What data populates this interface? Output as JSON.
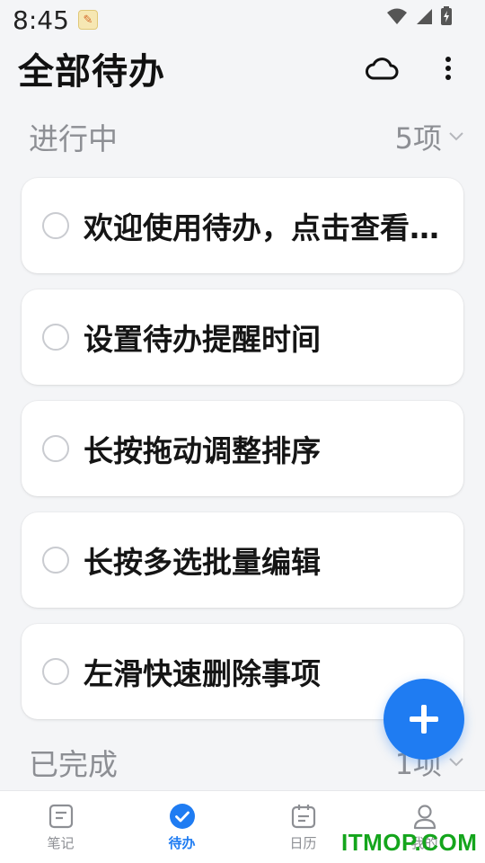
{
  "status_bar": {
    "time": "8:45"
  },
  "header": {
    "title": "全部待办"
  },
  "in_progress": {
    "title": "进行中",
    "count": "5项"
  },
  "todos": [
    {
      "text": "欢迎使用待办，点击查看…"
    },
    {
      "text": "设置待办提醒时间"
    },
    {
      "text": "长按拖动调整排序"
    },
    {
      "text": "长按多选批量编辑"
    },
    {
      "text": "左滑快速删除事项"
    }
  ],
  "completed": {
    "title": "已完成",
    "count": "1项"
  },
  "nav": [
    {
      "label": "笔记",
      "icon": "note-icon"
    },
    {
      "label": "待办",
      "icon": "check-circle-icon"
    },
    {
      "label": "日历",
      "icon": "calendar-icon"
    },
    {
      "label": "我的",
      "icon": "person-icon"
    }
  ],
  "watermark": "ITMOP.COM",
  "colors": {
    "accent": "#1f7cf2",
    "background": "#f4f5f7",
    "muted": "#8d8f94"
  }
}
